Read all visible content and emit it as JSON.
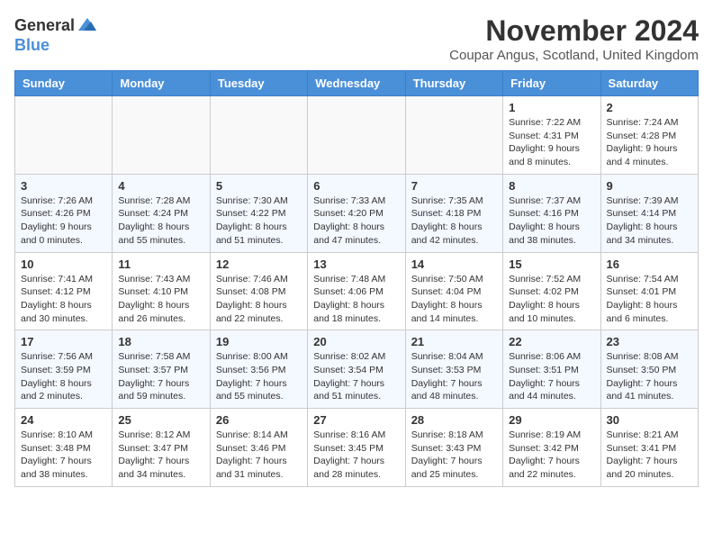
{
  "logo": {
    "general": "General",
    "blue": "Blue"
  },
  "title": "November 2024",
  "location": "Coupar Angus, Scotland, United Kingdom",
  "weekdays": [
    "Sunday",
    "Monday",
    "Tuesday",
    "Wednesday",
    "Thursday",
    "Friday",
    "Saturday"
  ],
  "weeks": [
    [
      {
        "day": "",
        "info": ""
      },
      {
        "day": "",
        "info": ""
      },
      {
        "day": "",
        "info": ""
      },
      {
        "day": "",
        "info": ""
      },
      {
        "day": "",
        "info": ""
      },
      {
        "day": "1",
        "info": "Sunrise: 7:22 AM\nSunset: 4:31 PM\nDaylight: 9 hours and 8 minutes."
      },
      {
        "day": "2",
        "info": "Sunrise: 7:24 AM\nSunset: 4:28 PM\nDaylight: 9 hours and 4 minutes."
      }
    ],
    [
      {
        "day": "3",
        "info": "Sunrise: 7:26 AM\nSunset: 4:26 PM\nDaylight: 9 hours and 0 minutes."
      },
      {
        "day": "4",
        "info": "Sunrise: 7:28 AM\nSunset: 4:24 PM\nDaylight: 8 hours and 55 minutes."
      },
      {
        "day": "5",
        "info": "Sunrise: 7:30 AM\nSunset: 4:22 PM\nDaylight: 8 hours and 51 minutes."
      },
      {
        "day": "6",
        "info": "Sunrise: 7:33 AM\nSunset: 4:20 PM\nDaylight: 8 hours and 47 minutes."
      },
      {
        "day": "7",
        "info": "Sunrise: 7:35 AM\nSunset: 4:18 PM\nDaylight: 8 hours and 42 minutes."
      },
      {
        "day": "8",
        "info": "Sunrise: 7:37 AM\nSunset: 4:16 PM\nDaylight: 8 hours and 38 minutes."
      },
      {
        "day": "9",
        "info": "Sunrise: 7:39 AM\nSunset: 4:14 PM\nDaylight: 8 hours and 34 minutes."
      }
    ],
    [
      {
        "day": "10",
        "info": "Sunrise: 7:41 AM\nSunset: 4:12 PM\nDaylight: 8 hours and 30 minutes."
      },
      {
        "day": "11",
        "info": "Sunrise: 7:43 AM\nSunset: 4:10 PM\nDaylight: 8 hours and 26 minutes."
      },
      {
        "day": "12",
        "info": "Sunrise: 7:46 AM\nSunset: 4:08 PM\nDaylight: 8 hours and 22 minutes."
      },
      {
        "day": "13",
        "info": "Sunrise: 7:48 AM\nSunset: 4:06 PM\nDaylight: 8 hours and 18 minutes."
      },
      {
        "day": "14",
        "info": "Sunrise: 7:50 AM\nSunset: 4:04 PM\nDaylight: 8 hours and 14 minutes."
      },
      {
        "day": "15",
        "info": "Sunrise: 7:52 AM\nSunset: 4:02 PM\nDaylight: 8 hours and 10 minutes."
      },
      {
        "day": "16",
        "info": "Sunrise: 7:54 AM\nSunset: 4:01 PM\nDaylight: 8 hours and 6 minutes."
      }
    ],
    [
      {
        "day": "17",
        "info": "Sunrise: 7:56 AM\nSunset: 3:59 PM\nDaylight: 8 hours and 2 minutes."
      },
      {
        "day": "18",
        "info": "Sunrise: 7:58 AM\nSunset: 3:57 PM\nDaylight: 7 hours and 59 minutes."
      },
      {
        "day": "19",
        "info": "Sunrise: 8:00 AM\nSunset: 3:56 PM\nDaylight: 7 hours and 55 minutes."
      },
      {
        "day": "20",
        "info": "Sunrise: 8:02 AM\nSunset: 3:54 PM\nDaylight: 7 hours and 51 minutes."
      },
      {
        "day": "21",
        "info": "Sunrise: 8:04 AM\nSunset: 3:53 PM\nDaylight: 7 hours and 48 minutes."
      },
      {
        "day": "22",
        "info": "Sunrise: 8:06 AM\nSunset: 3:51 PM\nDaylight: 7 hours and 44 minutes."
      },
      {
        "day": "23",
        "info": "Sunrise: 8:08 AM\nSunset: 3:50 PM\nDaylight: 7 hours and 41 minutes."
      }
    ],
    [
      {
        "day": "24",
        "info": "Sunrise: 8:10 AM\nSunset: 3:48 PM\nDaylight: 7 hours and 38 minutes."
      },
      {
        "day": "25",
        "info": "Sunrise: 8:12 AM\nSunset: 3:47 PM\nDaylight: 7 hours and 34 minutes."
      },
      {
        "day": "26",
        "info": "Sunrise: 8:14 AM\nSunset: 3:46 PM\nDaylight: 7 hours and 31 minutes."
      },
      {
        "day": "27",
        "info": "Sunrise: 8:16 AM\nSunset: 3:45 PM\nDaylight: 7 hours and 28 minutes."
      },
      {
        "day": "28",
        "info": "Sunrise: 8:18 AM\nSunset: 3:43 PM\nDaylight: 7 hours and 25 minutes."
      },
      {
        "day": "29",
        "info": "Sunrise: 8:19 AM\nSunset: 3:42 PM\nDaylight: 7 hours and 22 minutes."
      },
      {
        "day": "30",
        "info": "Sunrise: 8:21 AM\nSunset: 3:41 PM\nDaylight: 7 hours and 20 minutes."
      }
    ]
  ]
}
